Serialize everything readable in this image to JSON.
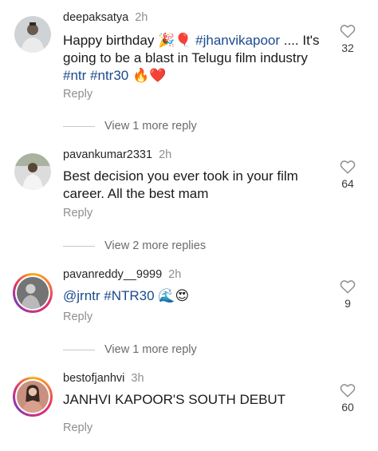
{
  "comments": [
    {
      "username": "deepaksatya",
      "time": "2h",
      "text_pre": "Happy birthday ",
      "emoji_a": "🎉🎈",
      "tag1": "#jhanvikapoor",
      "text_mid": " .... It's going to be a blast in Telugu film industry ",
      "tag2": "#ntr",
      "tag3": "#ntr30",
      "emoji_b": "🔥❤️",
      "likes": "32",
      "reply": "Reply",
      "view_more": "View 1 more reply"
    },
    {
      "username": "pavankumar2331",
      "time": "2h",
      "text": "Best decision you ever took in your film career. All the best mam",
      "likes": "64",
      "reply": "Reply",
      "view_more": "View 2 more replies"
    },
    {
      "username": "pavanreddy__9999",
      "time": "2h",
      "tag1": "@jrntr",
      "tag2": "#NTR30",
      "emoji": "🌊😍",
      "likes": "9",
      "reply": "Reply",
      "view_more": "View 1 more reply"
    },
    {
      "username": "bestofjanhvi",
      "time": "3h",
      "text": "JANHVI KAPOOR'S SOUTH DEBUT",
      "likes": "60",
      "reply": "Reply"
    }
  ],
  "icons": {
    "like": "heart-outline-icon"
  },
  "colors": {
    "hashtag": "#1b4a8c",
    "muted": "#8e8e8e"
  }
}
